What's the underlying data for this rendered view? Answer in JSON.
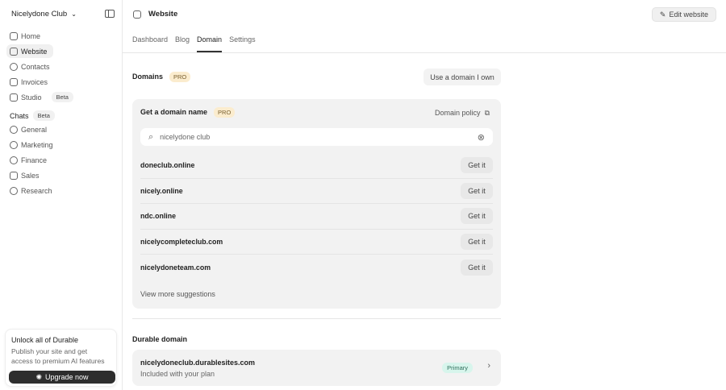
{
  "sidebar": {
    "workspace": "Nicelydone Club",
    "items": [
      {
        "label": "Home",
        "active": false
      },
      {
        "label": "Website",
        "active": true
      },
      {
        "label": "Contacts"
      },
      {
        "label": "Invoices"
      },
      {
        "label": "Studio",
        "badge": "Beta"
      }
    ],
    "chats_label": "Chats",
    "chats_badge": "Beta",
    "chats": [
      {
        "label": "General"
      },
      {
        "label": "Marketing"
      },
      {
        "label": "Finance"
      },
      {
        "label": "Sales"
      },
      {
        "label": "Research"
      }
    ],
    "promo": {
      "title": "Unlock all of Durable",
      "text": "Publish your site and get access to premium AI features",
      "button": "Upgrade now"
    }
  },
  "header": {
    "title": "Website",
    "edit": "Edit website"
  },
  "tabs": [
    {
      "label": "Dashboard"
    },
    {
      "label": "Blog"
    },
    {
      "label": "Domain",
      "active": true
    },
    {
      "label": "Settings"
    }
  ],
  "domains": {
    "title": "Domains",
    "badge": "PRO",
    "use_own": "Use a domain I own",
    "get_title": "Get a domain name",
    "get_badge": "PRO",
    "policy": "Domain policy",
    "search_value": "nicelydone club",
    "suggestions": [
      {
        "name": "doneclub.online",
        "action": "Get it"
      },
      {
        "name": "nicely.online",
        "action": "Get it"
      },
      {
        "name": "ndc.online",
        "action": "Get it"
      },
      {
        "name": "nicelycompleteclub.com",
        "action": "Get it"
      },
      {
        "name": "nicelydoneteam.com",
        "action": "Get it"
      }
    ],
    "view_more": "View more suggestions"
  },
  "durable": {
    "title": "Durable domain",
    "domain": "nicelydoneclub.durablesites.com",
    "sub": "Included with your plan",
    "badge": "Primary"
  }
}
